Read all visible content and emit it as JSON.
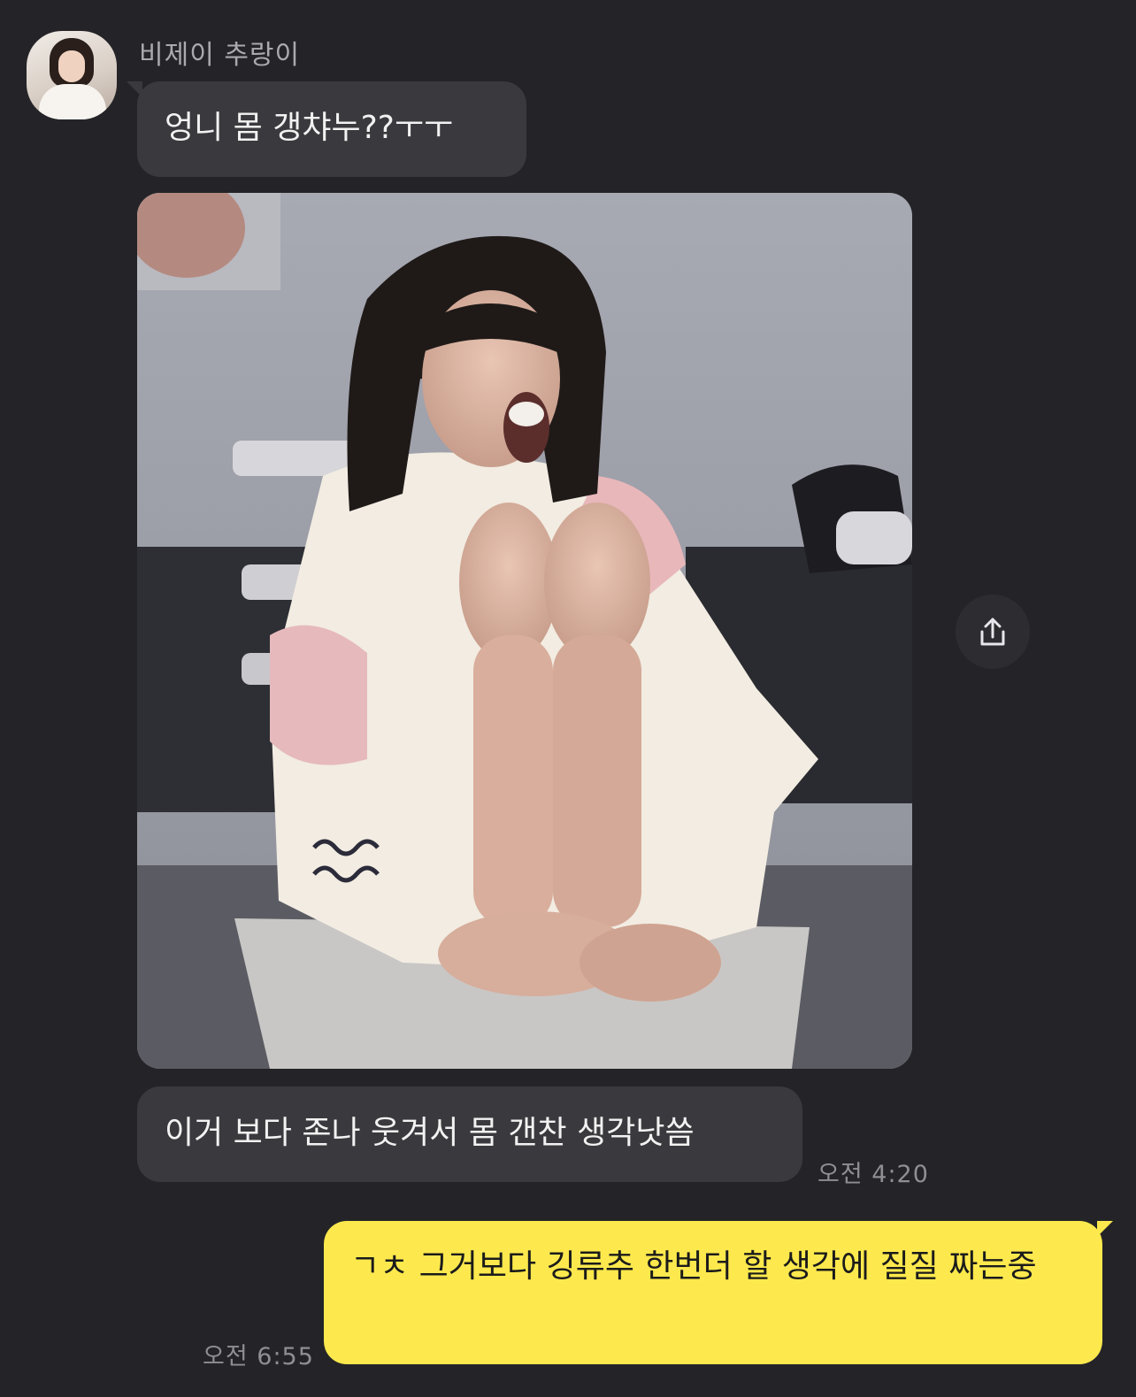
{
  "chat": {
    "sender_name": "비제이 추랑이",
    "messages": [
      {
        "text": "엉니 몸 갱챠누??ㅜㅜ"
      },
      {
        "text": "이거 보다 존나 웃겨서 몸 갠찬 생각낫씀",
        "time": "오전 4:20"
      }
    ],
    "my_message": {
      "text": "ㄱㅊ 그거보다 깅류추 한번더 할 생각에 질질 짜는중",
      "time": "오전 6:55"
    }
  },
  "icons": {
    "share": "share-icon"
  },
  "colors": {
    "background": "#242428",
    "incoming_bubble": "#3a3a3e",
    "outgoing_bubble": "#fde94d"
  }
}
